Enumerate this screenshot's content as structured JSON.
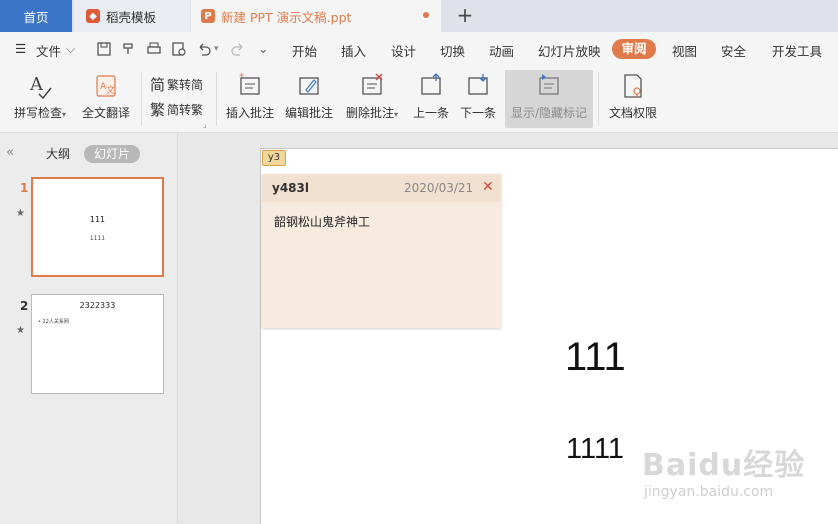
{
  "tabs": {
    "home": "首页",
    "template": "稻壳模板",
    "document": "新建 PPT 演示文稿.ppt",
    "new_tab": "+"
  },
  "menu": {
    "file": "文件",
    "items": [
      "开始",
      "插入",
      "设计",
      "切换",
      "动画",
      "幻灯片放映",
      "审阅",
      "视图",
      "安全",
      "开发工具"
    ],
    "active": "审阅"
  },
  "ribbon": {
    "spell_check": "拼写检查",
    "full_translate": "全文翻译",
    "trad_to_simp": "繁转简",
    "simp_to_trad": "简转繁",
    "insert_comment": "插入批注",
    "edit_comment": "编辑批注",
    "delete_comment": "删除批注",
    "prev": "上一条",
    "next": "下一条",
    "show_hide_markup": "显示/隐藏标记",
    "doc_permission": "文档权限"
  },
  "left_panel": {
    "tab_outline": "大纲",
    "tab_slides": "幻灯片",
    "slides": [
      {
        "number": "1",
        "title": "111",
        "body": "1111"
      },
      {
        "number": "2",
        "title": "2322333",
        "body": "• 22人关系网"
      }
    ]
  },
  "slide": {
    "title": "111",
    "subtitle": "1111"
  },
  "comment": {
    "marker": "y3",
    "author": "y483l",
    "date": "2020/03/21",
    "text": "韶钢松山鬼斧神工"
  },
  "watermark": {
    "logo": "Baidu经验",
    "url": "jingyan.baidu.com"
  },
  "colors": {
    "accent": "#e07a4a",
    "home_tab": "#3b75c8",
    "selected_thumb_border": "#e07a4a"
  }
}
